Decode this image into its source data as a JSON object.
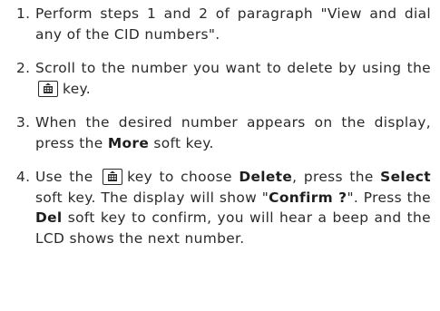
{
  "steps": [
    {
      "number": "1.",
      "text": "Perform steps 1 and 2 of paragraph \"View and dial any of the CID numbers\"."
    },
    {
      "number": "2.",
      "before": "Scroll to the number you want to delete by using the",
      "after": "key.",
      "icon": "scroll-key-icon"
    },
    {
      "number": "3.",
      "before": "When the desired number appears on the display, press the",
      "bold": "More",
      "after": "soft key."
    },
    {
      "number": "4.",
      "t1": "Use the",
      "icon": "scroll-key-icon",
      "t2": "key to choose",
      "b1": "Delete",
      "t3": ", press the",
      "b2": "Select",
      "t4": "soft key. The display will show \"",
      "b3": "Confirm ?",
      "t5": "\". Press the",
      "b4": "Del",
      "t6": "soft key to confirm, you will hear a beep and the LCD shows the next number."
    }
  ]
}
